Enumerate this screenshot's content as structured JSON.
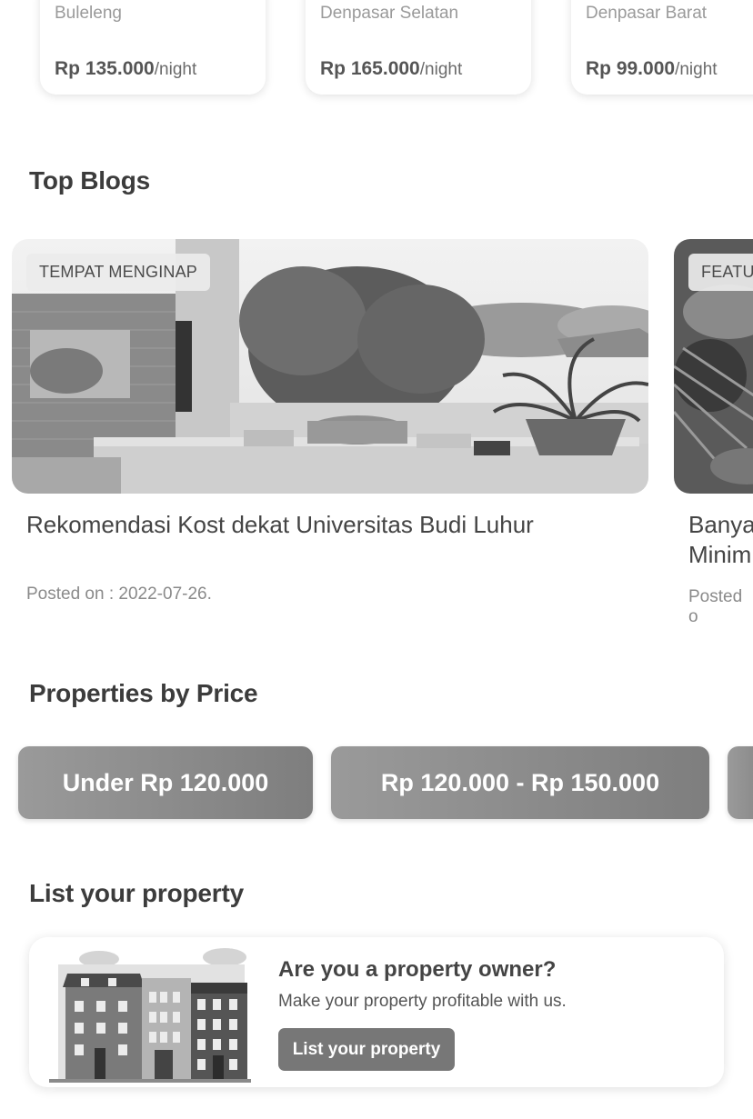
{
  "properties": [
    {
      "location": "Buleleng",
      "price": "Rp 135.000",
      "per": "/night"
    },
    {
      "location": "Denpasar Selatan",
      "price": "Rp 165.000",
      "per": "/night"
    },
    {
      "location": "Denpasar Barat",
      "price": "Rp 99.000",
      "per": "/night"
    }
  ],
  "blogs_section": {
    "title": "Top Blogs"
  },
  "blogs": [
    {
      "badge": "TEMPAT MENGINAP",
      "title": "Rekomendasi Kost dekat Universitas Budi Luhur",
      "date": "Posted on : 2022-07-26."
    },
    {
      "badge": "FEATU",
      "title_line1": "Banya",
      "title_line2": "Minim",
      "date": "Posted o"
    }
  ],
  "price_section": {
    "title": "Properties by Price",
    "buttons": [
      "Under Rp 120.000",
      "Rp 120.000 - Rp 150.000"
    ]
  },
  "list_section": {
    "title": "List your property",
    "card_title": "Are you a property owner?",
    "card_subtitle": "Make your property profitable with us.",
    "button_label": "List your property"
  }
}
